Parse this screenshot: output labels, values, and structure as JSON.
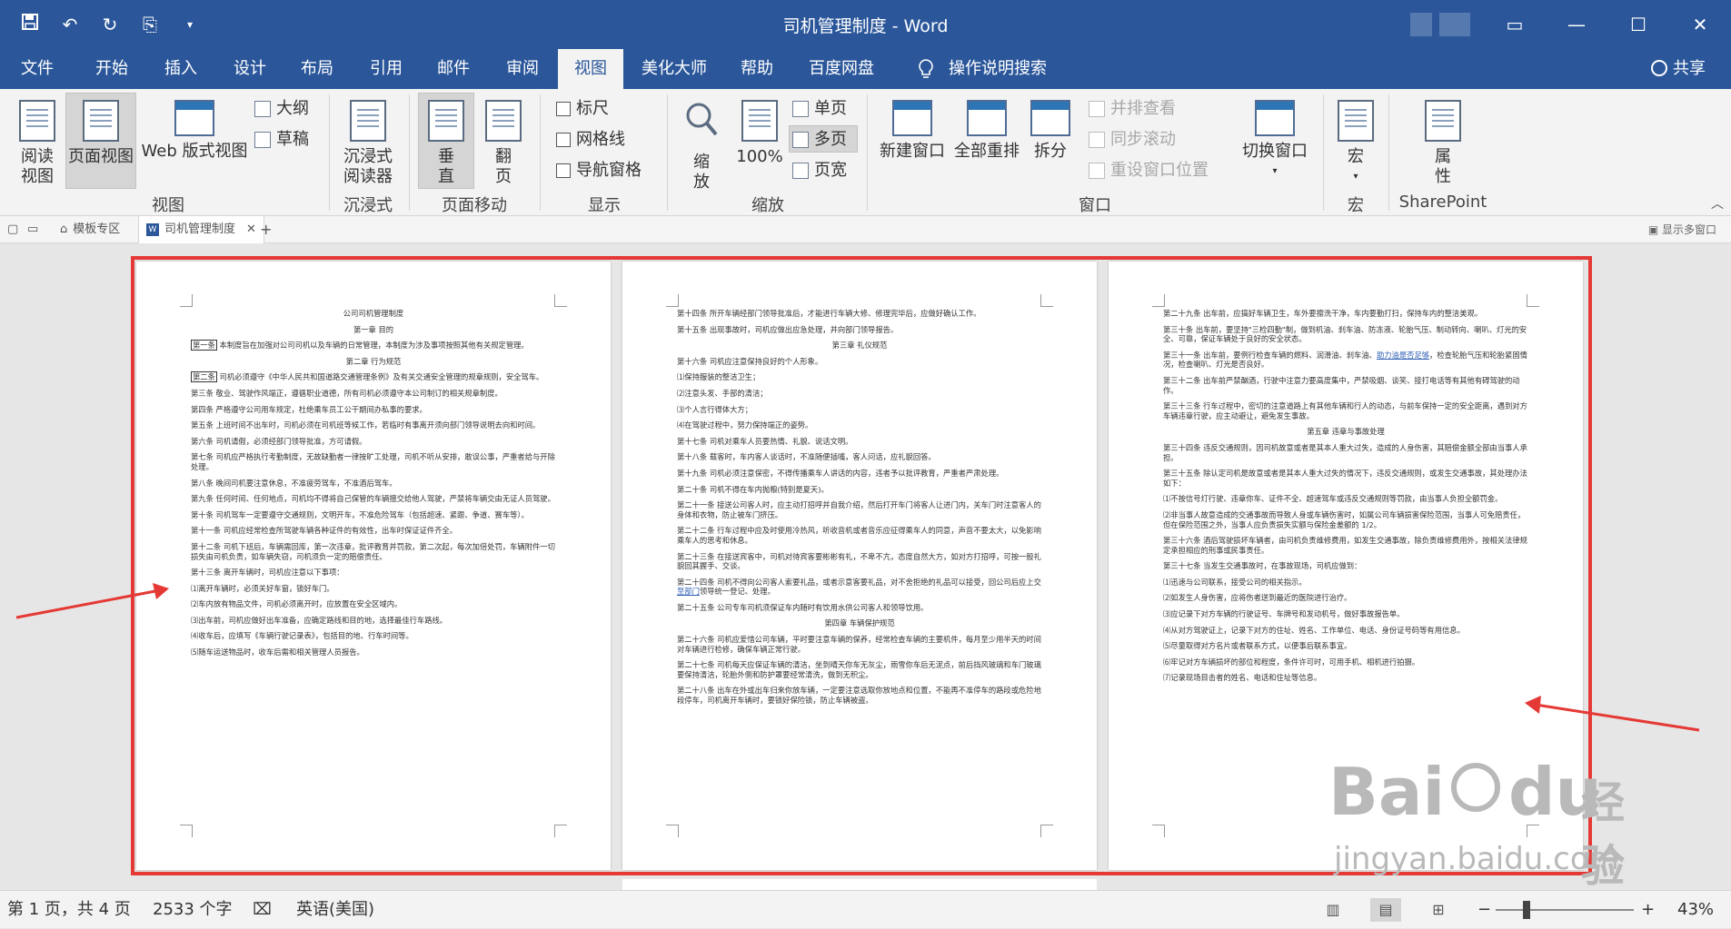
{
  "window": {
    "title": "司机管理制度 - Word",
    "qat": {
      "save": "save-icon",
      "undo": "undo-icon",
      "redo": "redo-icon",
      "format": "format-painter-icon",
      "customize": "customize-icon"
    },
    "controls": {
      "ribbon_display": "▭",
      "minimize": "—",
      "maximize": "☐",
      "close": "✕"
    }
  },
  "tabs": {
    "file": "文件",
    "home": "开始",
    "insert": "插入",
    "design": "设计",
    "layout": "布局",
    "references": "引用",
    "mailings": "邮件",
    "review": "审阅",
    "view": "视图",
    "meihua": "美化大师",
    "help": "帮助",
    "baidu": "百度网盘",
    "tell_me": "操作说明搜索",
    "share": "共享"
  },
  "ribbon": {
    "views": {
      "read_mode": "阅读\n视图",
      "print_layout": "页面视图",
      "web_layout": "Web 版式视图",
      "outline": "大纲",
      "draft": "草稿",
      "group": "视图"
    },
    "immersive": {
      "reader": "沉浸式\n阅读器",
      "group": "沉浸式"
    },
    "page_movement": {
      "vertical": "垂\n直",
      "side_to_side": "翻\n页",
      "group": "页面移动"
    },
    "show": {
      "ruler": "标尺",
      "gridlines": "网格线",
      "nav_pane": "导航窗格",
      "group": "显示"
    },
    "zoom": {
      "zoom": "缩\n放",
      "hundred": "100%",
      "one_page": "单页",
      "multiple_pages": "多页",
      "page_width": "页宽",
      "group": "缩放"
    },
    "window": {
      "new_window": "新建窗口",
      "arrange_all": "全部重排",
      "split": "拆分",
      "side_by_side": "并排查看",
      "sync_scroll": "同步滚动",
      "reset_position": "重设窗口位置",
      "switch_windows": "切换窗口",
      "group": "窗口"
    },
    "macros": {
      "macros": "宏",
      "group": "宏"
    },
    "sharepoint": {
      "properties": "属\n性",
      "group": "SharePoint"
    }
  },
  "doc_tabs": {
    "template_zone": "模板专区",
    "current_doc": "司机管理制度",
    "multi_window": "显示多窗口"
  },
  "pages": [
    {
      "title": "公司司机管理制度",
      "chapter1": "第一章  目的",
      "a1_label": "第一条",
      "a1": "本制度旨在加强对公司司机以及车辆的日常管理，本制度为涉及事项按照其他有关规定管理。",
      "chapter2": "第二章  行为规范",
      "a2_label": "第二条",
      "a2": "司机必须遵守《中华人民共和国道路交通管理条例》及有关交通安全管理的规章规则，安全驾车。",
      "a3": "第三条  敬业、驾驶作风端正，遵循职业道德，所有司机必须遵守本公司制订的相关规章制度。",
      "a4": "第四条  严格遵守公司用车规定，杜绝乘车员工公干期间办私事的要求。",
      "a5": "第五条  上班时间不出车时，司机必须在司机班等候工作，若临时有事离开须向部门领导说明去向和时间。",
      "a6": "第六条  司机请假，必须经部门领导批准，方可请假。",
      "a7": "第七条  司机应严格执行考勤制度，无故缺勤者一律按旷工处理，司机不听从安排，敢误公事，严重者给与开除处理。",
      "a8": "第八条  晚间司机要注意休息，不准疲劳驾车，不准酒后驾车。",
      "a9": "第九条  任何时间、任何地点，司机均不得将自己保管的车辆擅交给他人驾驶，严禁将车辆交由无证人员驾驶。",
      "a10": "第十条  司机驾车一定要遵守交通规则，文明开车，不准危险驾车（包括超速、紧跟、争道、赛车等）。",
      "a11": "第十一条  司机应经常检查所驾驶车辆各种证件的有效性，出车时保证证件齐全。",
      "a12": "第十二条  司机下班后，车辆需回库，第一次违章，批评教育并罚款，第二次起，每次加倍处罚，车辆附件一切损失由司机负责，如车辆失窃，司机须负一定的赔偿责任。",
      "a13": "第十三条  离开车辆时，司机应注意以下事项：",
      "l1": "⑴离开车辆时，必须关好车窗，锁好车门。",
      "l2": "⑵车内放有物品文件，司机必须离开时，应放置在安全区域内。",
      "l3": "⑶出车前，司机应做好出车准备，应确定路线和目的地，选择最佳行车路线。",
      "l4": "⑷收车后，应填写《车辆行驶记录表》，包括目的地、行车时间等。",
      "l5": "⑸随车运送物品时，收车后需和相关管理人员报告。"
    },
    {
      "a14": "第十四条  所开车辆经部门领导批准后，才能进行车辆大修、修理完毕后，应做好确认工作。",
      "a15": "第十五条  出现事故时，司机应做出应急处理，并向部门领导报告。",
      "chapter3": "第三章  礼仪规范",
      "a16": "第十六条  司机应注意保持良好的个人形象。",
      "l1": "⑴保持服装的整洁卫生；",
      "l2": "⑵注意头发、手部的清洁；",
      "l3": "⑶个人言行得体大方；",
      "l4": "⑷在驾驶过程中，努力保持端正的姿势。",
      "a17": "第十七条  司机对乘车人员要热情、礼貌、说话文明。",
      "a18": "第十八条  载客时，车内客人谈话时，不准随便插嘴，客人问话，应礼貌回答。",
      "a19": "第十九条  司机必须注意保密，不得传播乘车人讲话的内容，违者予以批评教育，严重者严肃处理。",
      "a20": "第二十条  司机不得在车内抛粮(特别是夏天)。",
      "a21": "第二十一条  接送公司客人时，应主动打招呼并自我介绍，然后打开车门将客人让进门内，关车门时注意客人的身体和衣物，防止被车门挤压。",
      "a22": "第二十二条  行车过程中应及时使用冷热风，听收音机或者音乐应征得乘车人的同意，声音不要太大，以免影响乘车人的思考和休息。",
      "a23": "第二十三条  在接送宾客中，司机对待宾客要彬彬有礼，不卑不亢，态度自然大方，如对方打招呼，可按一般礼貌回其握手、交谈。",
      "a24_pre": "第二十四条  司机不得向公司客人索要礼品，或者示意客要礼品，对不舍拒绝的礼品可以接受，回公司后应上交",
      "a24_link": "至部门",
      "a24_post": "领导统一登记、处理。",
      "a25": "第二十五条  公司专车司机须保证车内随时有饮用水供公司客人和领导饮用。",
      "chapter4": "第四章  车辆保护规范",
      "a26": "第二十六条  司机应爱惜公司车辆，平时要注意车辆的保养，经常检查车辆的主要机件，每月至少用半天的时间对车辆进行检修，确保车辆正常行驶。",
      "a27": "第二十七条  司机每天应保证车辆的清洁，坐到晴天你车无灰尘，雨雪你车后无泥点，前后挡风玻璃和车门玻璃要保持清洁，轮胎外侧和防护罩要经常清洗，做到无积尘。",
      "a28": "第二十八条  出车在外或出车归来你放车辆，一定要注意选取你放地点和位置，不能再不准停车的路段或危险地段停车，司机离开车辆时，要锁好保险锁，防止车辆被盗。"
    },
    {
      "a29": "第二十九条  出车前，应搞好车辆卫生，车外要擦洗干净，车内要勤打扫，保持车内的整洁美观。",
      "a30": "第三十条  出车前，要坚持\"三检四勤\"制，做到机油、刹车油、防冻液、轮胎气压、制动转向、喇叭、灯光的安全、可靠，保证车辆处于良好的安全状态。",
      "a31_pre": "第三十一条  出车前，要例行检查车辆的燃料、润滑油、刹车油、",
      "a31_link": "助力油是否足够",
      "a31_post": "，检查轮胎气压和轮胎紧固情况，检查喇叭、灯光是否良好。",
      "a32": "第三十二条  出车前严禁酗酒，行驶中注意力要高度集中，严禁吸烟、谈笑、接打电话等有其他有碍驾驶的动作。",
      "a33": "第三十三条  行车过程中，密切的注意道路上有其他车辆和行人的动态，与前车保持一定的安全距离，遇到对方车辆违章行驶，应主动避让，避免发生事故。",
      "chapter5": "第五章  违章与事故处理",
      "a34": "第三十四条  违反交通规则，因司机故意或者是其本人重大过失，造成的人身伤害，其赔偿金额全部由当事人承担。",
      "a35": "第三十五条  除认定司机是故意或者是其本人重大过失的情况下，违反交通规则，或发生交通事故，其处理办法如下：",
      "l1": "⑴不按信号灯行驶、违章你车、证件不全、超速驾车或违反交通规则等罚款，由当事人负担全额罚金。",
      "l2": "⑵非当事人故意造成的交通事故而导致人身或车辆伤害时，如属公司车辆损害保险范围，当事人可免赔责任，但在保险范围之外，当事人应负责损失实额与保险金差额的 1/2。",
      "a36": "第三十六条  酒后驾驶损坏车辆者，由司机负责维修费用，如发生交通事故，除负责维修费用外，按相关法律规定承担相应的刑事或民事责任。",
      "a37": "第三十七条  当发生交通事故时，在事故现场，司机应做到：",
      "l3": "⑴迅速与公司联系，接受公司的相关指示。",
      "l4": "⑵如发生人身伤害，应将伤者送到最近的医院进行治疗。",
      "l5": "⑶应记录下对方车辆的行驶证号、车牌号和发动机号，做好事故报告单。",
      "l6": "⑷从对方驾驶证上，记录下对方的住址、姓名、工作单位、电话、身份证号码等有用信息。",
      "l7": "⑸尽量取得对方名片或者联系方式，以便事后联系事宜。",
      "l8": "⑹牢记对方车辆损坏的部位和程度，条件许可时，可用手机、相机进行拍摄。",
      "l9": "⑺记录现场目击者的姓名、电话和住址等信息。"
    }
  ],
  "status": {
    "page": "第 1 页，共 4 页",
    "words": "2533 个字",
    "language": "英语(美国)",
    "zoom_level": "43%",
    "zoom_minus": "−",
    "zoom_plus": "+"
  },
  "watermark": {
    "brand": "Bai",
    "paw": "du",
    "jingyan": "经验",
    "url": "jingyan.baidu.com"
  },
  "colors": {
    "accent": "#2b579a",
    "annotation": "#e53935"
  }
}
